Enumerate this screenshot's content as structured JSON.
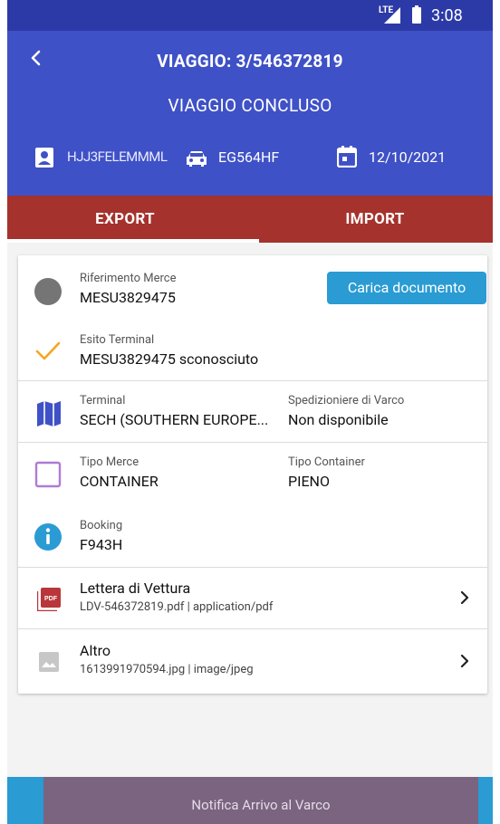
{
  "status_bar": {
    "network": "LTE",
    "time": "3:08"
  },
  "header": {
    "title": "VIAGGIO: 3/546372819",
    "subtitle": "VIAGGIO CONCLUSO",
    "driver_id": "HJJ3FELEMMML",
    "plate": "EG564HF",
    "date": "12/10/2021"
  },
  "tabs": [
    {
      "label": "EXPORT",
      "active": true
    },
    {
      "label": "IMPORT",
      "active": false
    }
  ],
  "card": {
    "riferimento": {
      "label": "Riferimento Merce",
      "value": "MESU3829475"
    },
    "upload_button": "Carica documento",
    "esito": {
      "label": "Esito Terminal",
      "value": "MESU3829475 sconosciuto"
    },
    "terminal": {
      "label": "Terminal",
      "value": "SECH (SOUTHERN EUROPE..."
    },
    "spedizioniere": {
      "label": "Spedizioniere di Varco",
      "value": "Non disponibile"
    },
    "tipo_merce": {
      "label": "Tipo Merce",
      "value": "CONTAINER"
    },
    "tipo_container": {
      "label": "Tipo Container",
      "value": "PIENO"
    },
    "booking": {
      "label": "Booking",
      "value": "F943H"
    },
    "documents": [
      {
        "title": "Lettera di Vettura",
        "subtitle": "LDV-546372819.pdf | application/pdf",
        "icon": "pdf-icon"
      },
      {
        "title": "Altro",
        "subtitle": "1613991970594.jpg | image/jpeg",
        "icon": "image-icon"
      }
    ]
  },
  "footer": {
    "button": "Notifica Arrivo al Varco"
  },
  "colors": {
    "status_bar": "#2c3aa8",
    "header": "#3f51c6",
    "tabs": "#a5322c",
    "accent_blue": "#2a9bd3",
    "check_orange": "#f5a623",
    "terminal_icon": "#3f51c6",
    "tipo_merce_icon": "#b07bd6",
    "pdf_icon": "#b9363a",
    "notify_button": "#7a6480"
  }
}
